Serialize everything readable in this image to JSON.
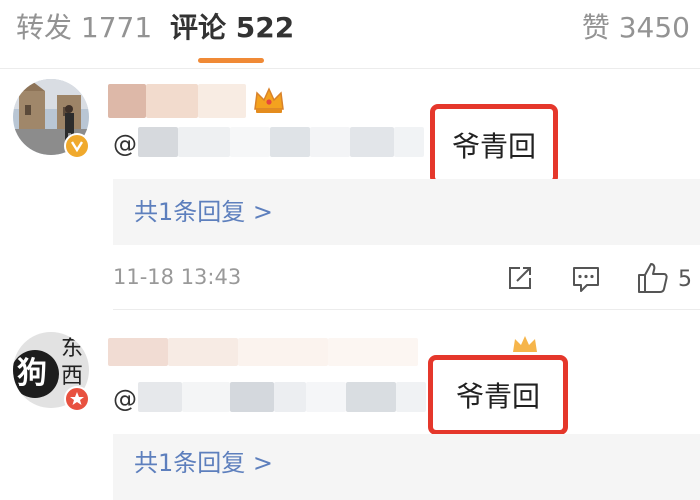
{
  "tabs": [
    {
      "label": "转发",
      "count": "1771"
    },
    {
      "label": "评论",
      "count": "522"
    },
    {
      "label": "赞",
      "count": "3450"
    }
  ],
  "comments": [
    {
      "mention_prefix": "@",
      "highlight": "爷青回",
      "reply_summary": "共1条回复 >",
      "timestamp": "11-18 13:43",
      "like_count": "5"
    },
    {
      "avatar_text_main": "狗",
      "avatar_text_side_1": "东",
      "avatar_text_side_2": "西",
      "mention_prefix": "@",
      "highlight": "爷青回",
      "reply_summary": "共1条回复 >"
    }
  ],
  "colors": {
    "accent": "#f08a36",
    "link": "#5d7fbd",
    "highlight_border": "#e5372b",
    "muted": "#999999"
  }
}
